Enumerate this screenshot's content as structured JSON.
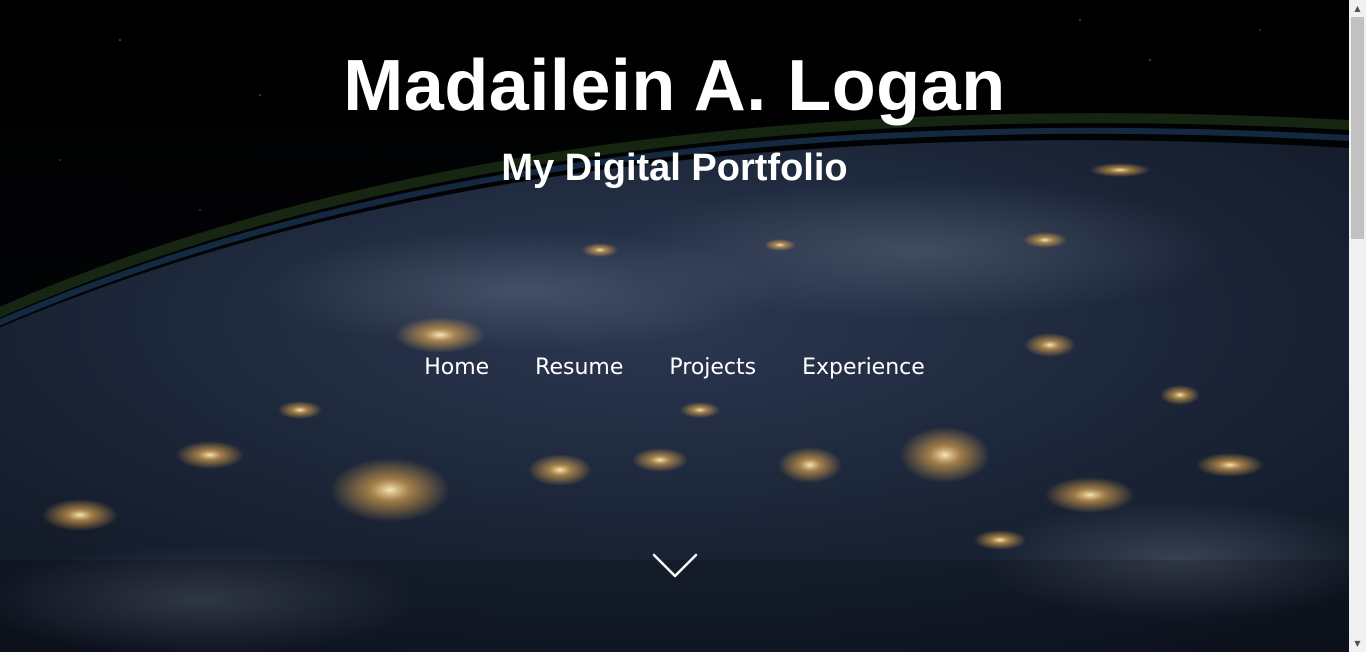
{
  "header": {
    "title": "Madailein A. Logan",
    "subtitle": "My Digital Portfolio"
  },
  "nav": {
    "items": [
      {
        "label": "Home"
      },
      {
        "label": "Resume"
      },
      {
        "label": "Projects"
      },
      {
        "label": "Experience"
      }
    ]
  },
  "icons": {
    "scroll_down": "chevron-down-icon",
    "scroll_up_arrow": "▲",
    "scroll_down_arrow": "▼"
  },
  "colors": {
    "text": "#ffffff",
    "background": "#020307",
    "scrollbar_track": "#f1f1f1",
    "scrollbar_thumb": "#c1c1c1"
  }
}
